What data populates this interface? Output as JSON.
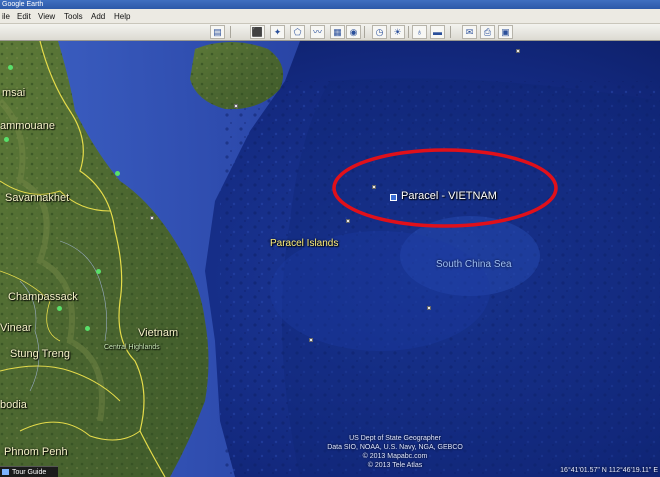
{
  "window": {
    "title": "Google Earth"
  },
  "menu": {
    "items": [
      "ile",
      "Edit",
      "View",
      "Tools",
      "Add",
      "Help"
    ]
  },
  "toolbar": {
    "buttons": [
      "hide-sidebar",
      "placemark",
      "polygon",
      "path",
      "image-overlay",
      "record-tour",
      "historical-imagery",
      "sun",
      "planets",
      "ruler",
      "email",
      "print",
      "view-in-maps"
    ]
  },
  "map": {
    "placemark_label": "Paracel - VIETNAM",
    "labels": {
      "paracel_islands": "Paracel Islands",
      "south_china_sea": "South China Sea",
      "vietnam": "Vietnam",
      "central_highlands": "Central Highlands",
      "savannakhet": "Savannakhet",
      "champassack": "Champassack",
      "stung_treng": "Stung Treng",
      "phnom_penh": "Phnom Penh",
      "msai": "msai",
      "ammouane": "ammouane",
      "vinear": "Vinear",
      "bodia": "bodia",
      "sea_noise": "South China Sea"
    },
    "credits": [
      "US Dept of State Geographer",
      "Data SIO, NOAA, U.S. Navy, NGA, GEBCO",
      "© 2013 Mapabc.com",
      "© 2013 Tele Atlas"
    ],
    "coordinates": "16°41'01.57\" N 112°46'19.11\" E",
    "highlight_color": "#e0101a"
  },
  "tour_guide": {
    "label": "Tour Guide"
  }
}
